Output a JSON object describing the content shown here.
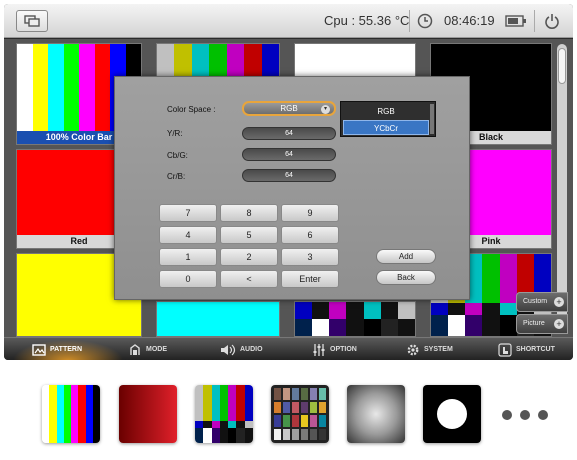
{
  "topbar": {
    "cpu_text": "Cpu : 55.36 °C",
    "time_text": "08:46:19",
    "icons": [
      "window-icon",
      "clock-icon",
      "battery-icon",
      "power-icon"
    ]
  },
  "tiles": {
    "color_bar_label": "100% Color Bar",
    "black_label": "Black",
    "red_label": "Red",
    "pink_label": "Pink"
  },
  "dialog": {
    "color_space_label": "Color Space :",
    "color_space_value": "RGB",
    "color_space_options": [
      "RGB",
      "YCbCr"
    ],
    "selected_option": "YCbCr",
    "fields": [
      {
        "label": "Y/R:",
        "value": "64"
      },
      {
        "label": "Cb/G:",
        "value": "64"
      },
      {
        "label": "Cr/B:",
        "value": "64"
      }
    ],
    "keypad": [
      "7",
      "8",
      "9",
      "4",
      "5",
      "6",
      "1",
      "2",
      "3",
      "0",
      "<",
      "Enter"
    ],
    "add_label": "Add",
    "back_label": "Back"
  },
  "side_buttons": {
    "custom_label": "Custom",
    "picture_label": "Picture"
  },
  "nav": {
    "items": [
      "PATTERN",
      "MODE",
      "AUDIO",
      "OPTION",
      "SYSTEM",
      "SHORTCUT"
    ],
    "active": "PATTERN",
    "active_color": "#f5a623"
  },
  "colors": {
    "dialog_bg": "#9a9a9a",
    "select_border": "#e8a53c",
    "selected_option_bg": "#3a76c4"
  }
}
